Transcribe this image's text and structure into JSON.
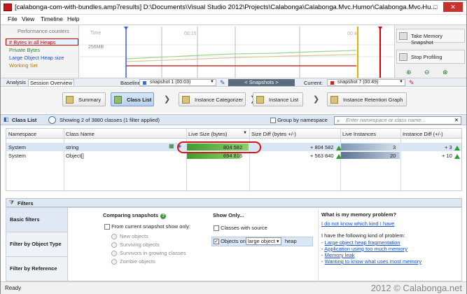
{
  "window": {
    "title": "[calabonga-com-with-bundles.amp7results]  D:\\Documents\\Visual Studio 2012\\Projects\\Calabonga\\Calabonga.Mvc.Humor\\Calabonga.Mvc.Hu...",
    "min": "–",
    "max": "□",
    "close": "✕"
  },
  "menu": [
    "File",
    "View",
    "Timeline",
    "Help"
  ],
  "counters": {
    "title": "Performance counters",
    "items": [
      "# Bytes in all Heaps",
      "Private Bytes",
      "Large Object Heap size",
      "Working Set"
    ]
  },
  "timeline": {
    "time_label": "Time",
    "mem_label": "256MB",
    "t1": "00:15",
    "t2": "00:4"
  },
  "right_panel": {
    "take_snapshot": "Take Memory Snapshot",
    "stop_profiling": "Stop Profiling"
  },
  "tabs": [
    "Analysis",
    "Session Overview"
  ],
  "snapshots": {
    "baseline_label": "Baseline:",
    "baseline_value": "snapshot 1 (00:03)",
    "center": "< Snapshots >",
    "current_label": "Current:",
    "current_value": "snapshot 7 (00:49)"
  },
  "nav": [
    "Summary",
    "Class List",
    "Instance Categorizer",
    "Instance List",
    "Instance Retention Graph"
  ],
  "classlist": {
    "title": "Class List",
    "count": "Showing 2 of 3880 classes (1 filter applied)",
    "group": "Group by namespace",
    "search_placeholder": "Enter namespace or class name..."
  },
  "table": {
    "headers": [
      "Namespace",
      "Class Name",
      "Live Size (bytes)",
      "Size Diff (bytes +/-)",
      "Live Instances",
      "Instance Diff (+/-)"
    ],
    "rows": [
      {
        "namespace": "System",
        "class": "string",
        "live": "804 582",
        "diff": "+ 804 582",
        "inst": "3",
        "idiff": "+ 3"
      },
      {
        "namespace": "System",
        "class": "Object[]",
        "live": "694 816",
        "diff": "+ 563 840",
        "inst": "20",
        "idiff": "+ 10"
      }
    ]
  },
  "filters": {
    "title": "Filters",
    "nav": [
      "Basic filters",
      "Filter by Object Type",
      "Filter by Reference"
    ],
    "comparing": "Comparing snapshots",
    "from_current": "From current snapshot show only:",
    "radios": [
      "New objects",
      "Surviving objects",
      "Survivors in growing classes",
      "Zombie objects"
    ],
    "show_only": "Show Only...",
    "classes_with_source": "Classes with source",
    "objects_on": "Objects on",
    "large_object": "large object",
    "heap": "heap",
    "help_title": "What is my memory problem?",
    "help_link": "I do not know which kind I have",
    "help_kind": "I have the following kind of problem:",
    "help_items": [
      "Large object heap fragmentation",
      "Application using too much memory",
      "Memory leak",
      "Wanting to know what uses most memory"
    ]
  },
  "status": "Ready",
  "watermark": "2012 © Calabonga.net"
}
